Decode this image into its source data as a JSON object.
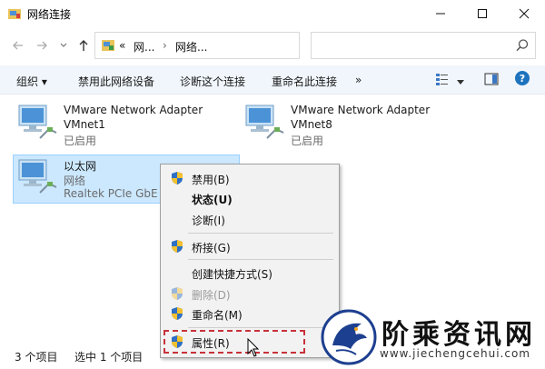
{
  "window": {
    "title": "网络连接",
    "minimize_icon": "minimize-icon",
    "maximize_icon": "maximize-icon",
    "close_icon": "close-icon"
  },
  "address": {
    "prefix": "«",
    "crumbs": [
      "网...",
      "网络..."
    ],
    "separator": "›",
    "search_placeholder": ""
  },
  "commandbar": {
    "organize": "组织 ▾",
    "disable": "禁用此网络设备",
    "diagnose": "诊断这个连接",
    "rename": "重命名此连接",
    "more": "»"
  },
  "items": [
    {
      "name": "VMware Network Adapter",
      "sub": "VMnet1",
      "status": "已启用"
    },
    {
      "name": "VMware Network Adapter",
      "sub": "VMnet8",
      "status": "已启用"
    },
    {
      "name": "以太网",
      "sub": "网络",
      "status": "Realtek PCIe GbE F"
    }
  ],
  "context_menu": {
    "items": [
      {
        "label": "禁用(B)",
        "shield": true
      },
      {
        "label": "状态(U)",
        "bold": true
      },
      {
        "label": "诊断(I)"
      },
      {
        "label": "桥接(G)",
        "shield": true
      },
      {
        "label": "创建快捷方式(S)"
      },
      {
        "label": "删除(D)",
        "shield": true,
        "disabled": true
      },
      {
        "label": "重命名(M)",
        "shield": true
      },
      {
        "label": "属性(R)",
        "shield": true
      }
    ]
  },
  "statusbar": {
    "count": "3 个项目",
    "selected": "选中 1 个项目"
  },
  "watermark": {
    "text": "阶乘资讯网",
    "url": "www.jiechengcehui.com"
  },
  "colors": {
    "selection": "#cce8ff",
    "commandbar": "#f0f6fb",
    "help": "#1e73be",
    "highlight_dash": "#c8323a"
  }
}
